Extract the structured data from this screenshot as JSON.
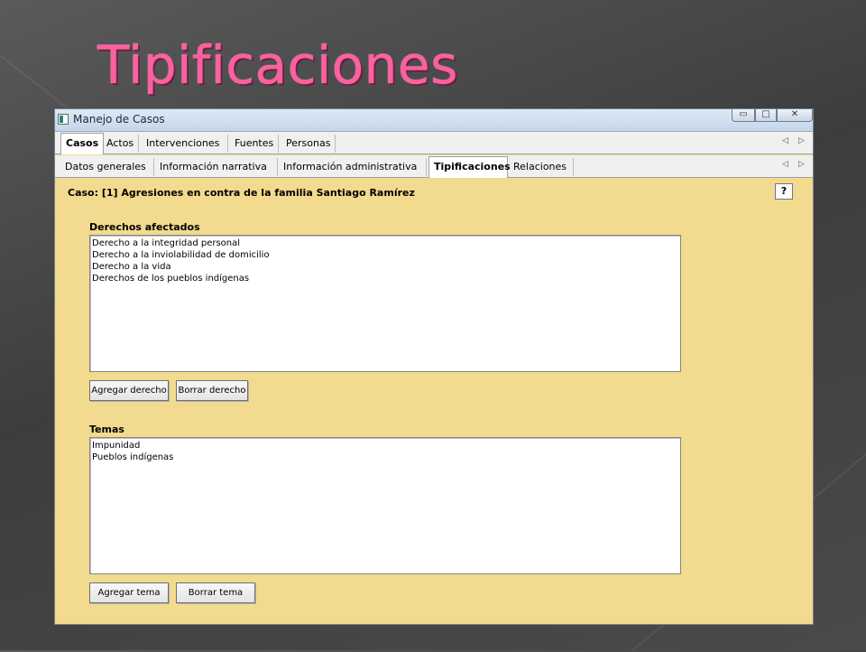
{
  "slide": {
    "title": "Tipificaciones"
  },
  "window": {
    "title": "Manejo de Casos",
    "minimize_glyph": "▭",
    "maximize_glyph": "□",
    "close_glyph": "✕"
  },
  "main_tabs": {
    "items": [
      {
        "label": "Casos",
        "active": true
      },
      {
        "label": "Actos",
        "active": false
      },
      {
        "label": "Intervenciones",
        "active": false
      },
      {
        "label": "Fuentes",
        "active": false
      },
      {
        "label": "Personas",
        "active": false
      }
    ],
    "scroll_left": "◁",
    "scroll_right": "▷"
  },
  "sub_tabs": {
    "items": [
      {
        "label": "Datos generales",
        "active": false
      },
      {
        "label": "Información narrativa",
        "active": false
      },
      {
        "label": "Información administrativa",
        "active": false
      },
      {
        "label": "Tipificaciones",
        "active": true
      },
      {
        "label": "Relaciones",
        "active": false
      }
    ],
    "scroll_left": "◁",
    "scroll_right": "▷"
  },
  "case": {
    "label": "Caso: [1] Agresiones en contra de la familia Santiago Ramírez"
  },
  "help_button": "?",
  "rights": {
    "heading": "Derechos afectados",
    "items": [
      "Derecho a la integridad personal",
      "Derecho a la inviolabilidad de domicilio",
      "Derecho a la vida",
      "Derechos de los pueblos indígenas"
    ],
    "add_button": "Agregar derecho",
    "delete_button": "Borrar derecho"
  },
  "themes": {
    "heading": "Temas",
    "items": [
      "Impunidad",
      "Pueblos indígenas"
    ],
    "add_button": "Agregar tema",
    "delete_button": "Borrar tema"
  },
  "colors": {
    "title_pink": "#ff5fa0",
    "panel_yellow": "#f2da8e",
    "slide_background": "#4a4a4a"
  }
}
